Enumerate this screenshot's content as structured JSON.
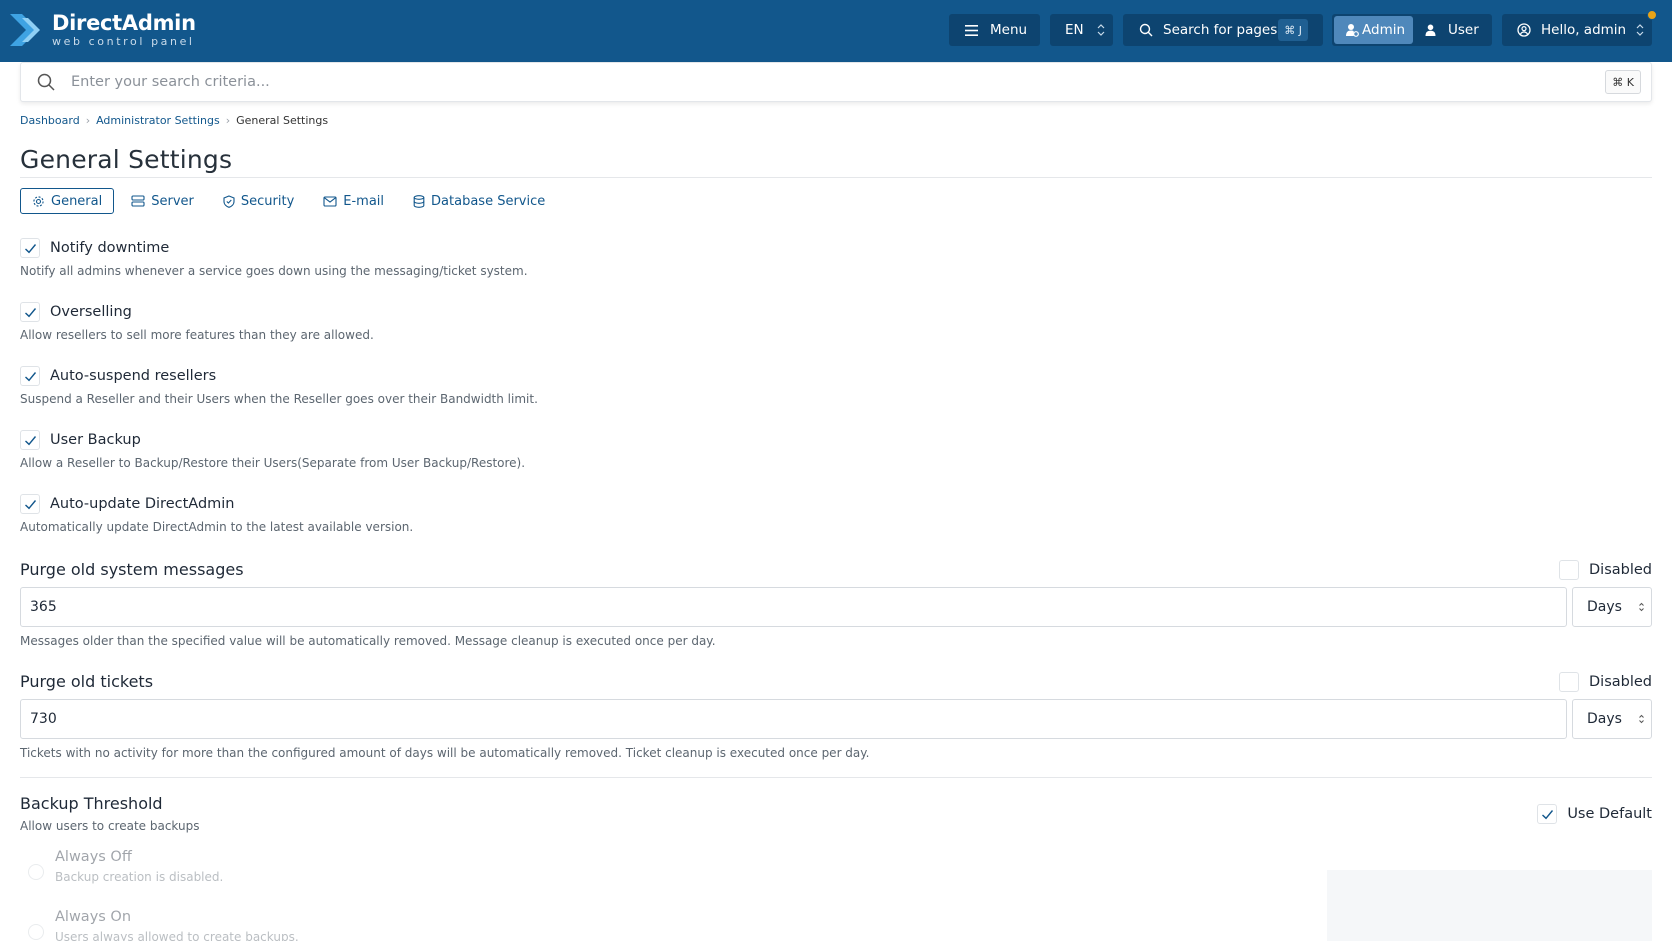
{
  "brand": {
    "title": "DirectAdmin",
    "subtitle": "web control panel"
  },
  "header": {
    "menu_label": "Menu",
    "language": "EN",
    "search_pages_label": "Search for pages",
    "search_pages_shortcut": "⌘ J",
    "role_admin": "Admin",
    "role_user": "User",
    "greeting": "Hello, admin",
    "notification_color": "#e8a317",
    "bar_color": "#12578c"
  },
  "search": {
    "placeholder": "Enter your search criteria...",
    "shortcut": "⌘ K"
  },
  "breadcrumb": [
    "Dashboard",
    "Administrator Settings",
    "General Settings"
  ],
  "page": {
    "title": "General Settings"
  },
  "tabs": [
    {
      "label": "General",
      "icon": "gear-icon",
      "active": true
    },
    {
      "label": "Server",
      "icon": "server-icon",
      "active": false
    },
    {
      "label": "Security",
      "icon": "shield-icon",
      "active": false
    },
    {
      "label": "E-mail",
      "icon": "mail-icon",
      "active": false
    },
    {
      "label": "Database Service",
      "icon": "database-icon",
      "active": false
    }
  ],
  "options": [
    {
      "label": "Notify downtime",
      "description": "Notify all admins whenever a service goes down using the messaging/ticket system.",
      "checked": true
    },
    {
      "label": "Overselling",
      "description": "Allow resellers to sell more features than they are allowed.",
      "checked": true
    },
    {
      "label": "Auto-suspend resellers",
      "description": "Suspend a Reseller and their Users when the Reseller goes over their Bandwidth limit.",
      "checked": true
    },
    {
      "label": "User Backup",
      "description": "Allow a Reseller to Backup/Restore their Users(Separate from User Backup/Restore).",
      "checked": true
    },
    {
      "label": "Auto-update DirectAdmin",
      "description": "Automatically update DirectAdmin to the latest available version.",
      "checked": true
    }
  ],
  "purge_messages": {
    "title": "Purge old system messages",
    "disabled_label": "Disabled",
    "disabled_checked": false,
    "value": "365",
    "unit": "Days",
    "help": "Messages older than the specified value will be automatically removed. Message cleanup is executed once per day."
  },
  "purge_tickets": {
    "title": "Purge old tickets",
    "disabled_label": "Disabled",
    "disabled_checked": false,
    "value": "730",
    "unit": "Days",
    "help": "Tickets with no activity for more than the configured amount of days will be automatically removed. Ticket cleanup is executed once per day."
  },
  "backup_threshold": {
    "title": "Backup Threshold",
    "subtitle": "Allow users to create backups",
    "use_default_label": "Use Default",
    "use_default_checked": true,
    "choices": [
      {
        "label": "Always Off",
        "description": "Backup creation is disabled."
      },
      {
        "label": "Always On",
        "description": "Users always allowed to create backups."
      }
    ]
  }
}
